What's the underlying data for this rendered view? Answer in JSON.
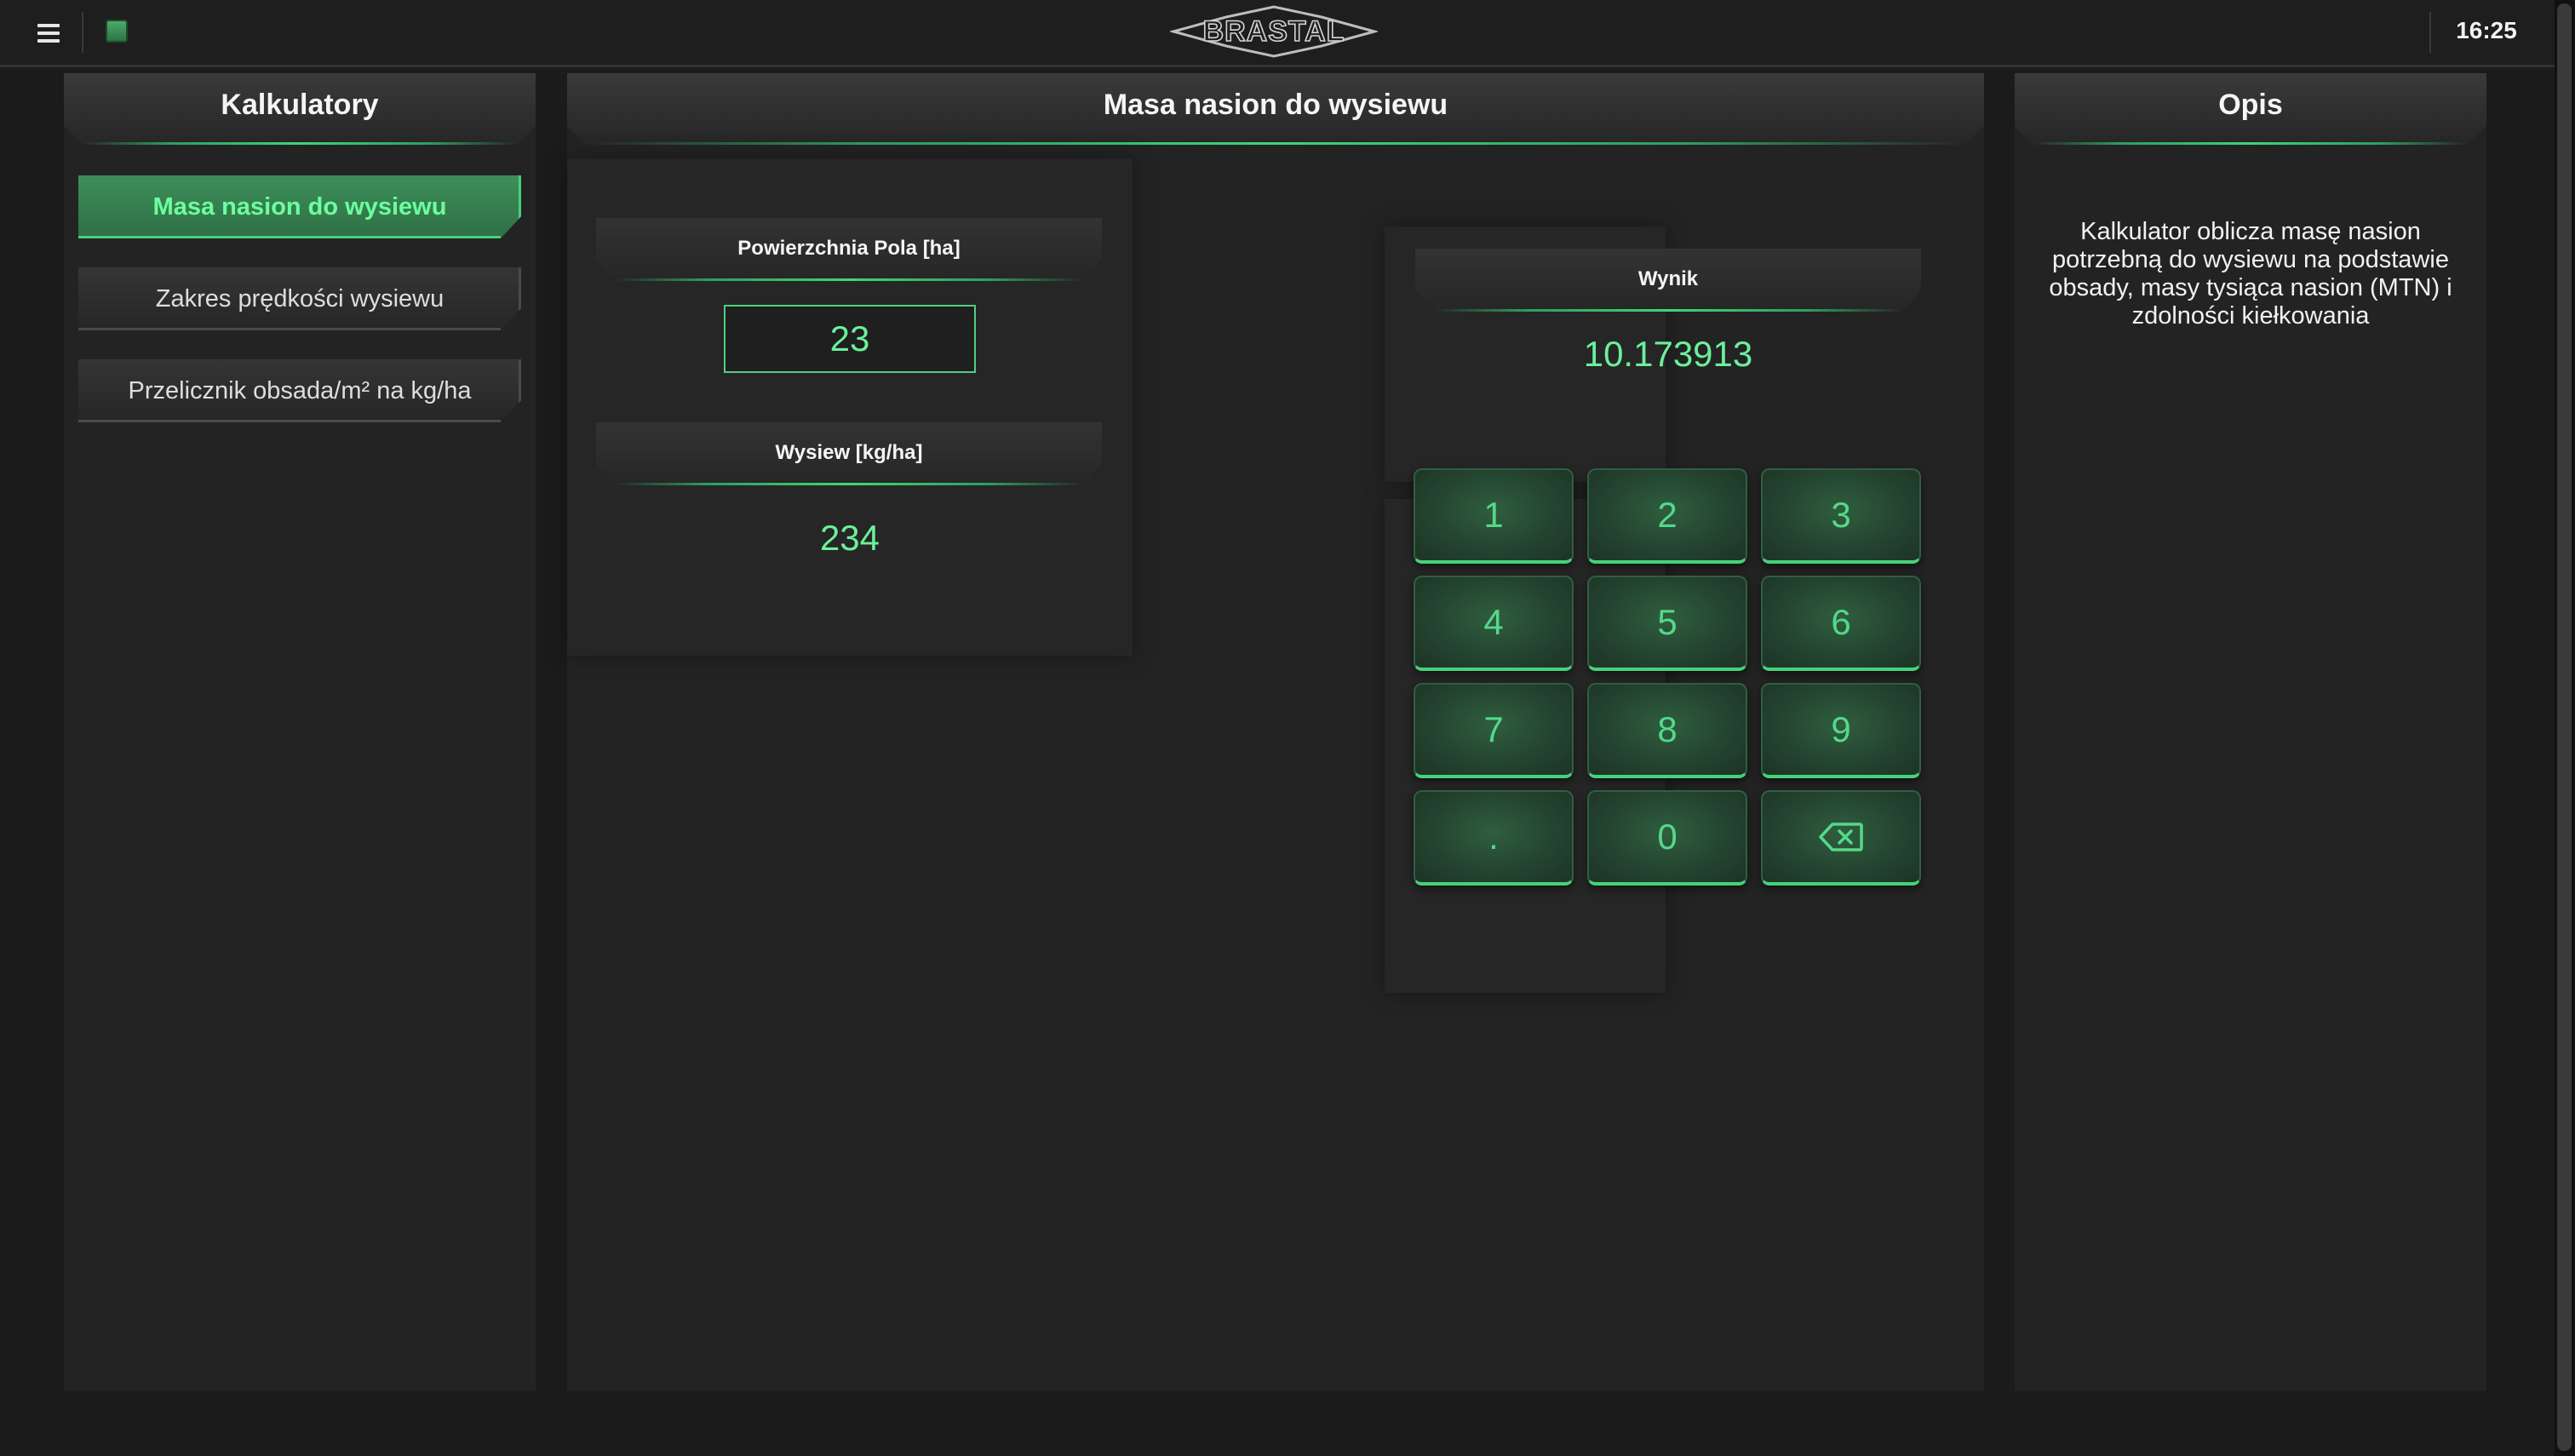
{
  "topbar": {
    "menu_icon": "hamburger-menu-icon",
    "app_icon": "green-square-app-icon",
    "logo_text": "BRASTAL",
    "clock": "16:25"
  },
  "left_panel": {
    "title": "Kalkulatory",
    "items": [
      {
        "label": "Masa nasion do wysiewu",
        "active": true
      },
      {
        "label": "Zakres prędkości wysiewu",
        "active": false
      },
      {
        "label": "Przelicznik obsada/m² na kg/ha",
        "active": false
      }
    ]
  },
  "center_panel": {
    "title": "Masa nasion do wysiewu",
    "fields": [
      {
        "label": "Powierzchnia Pola [ha]",
        "value": "23"
      },
      {
        "label": "Wysiew [kg/ha]",
        "value": "234"
      }
    ],
    "result": {
      "label": "Wynik",
      "value": "10.173913"
    },
    "keypad": [
      "1",
      "2",
      "3",
      "4",
      "5",
      "6",
      "7",
      "8",
      "9",
      ".",
      "0",
      "backspace-icon"
    ]
  },
  "right_panel": {
    "title": "Opis",
    "description": "Kalkulator oblicza masę nasion potrzebną do wysiewu na podstawie obsady, masy tysiąca nasion (MTN) i zdolności kiełkowania"
  },
  "colors": {
    "accent": "#4fce7f",
    "accent_text": "#6bf09b",
    "background": "#1b1b1b",
    "panel": "#232323"
  }
}
